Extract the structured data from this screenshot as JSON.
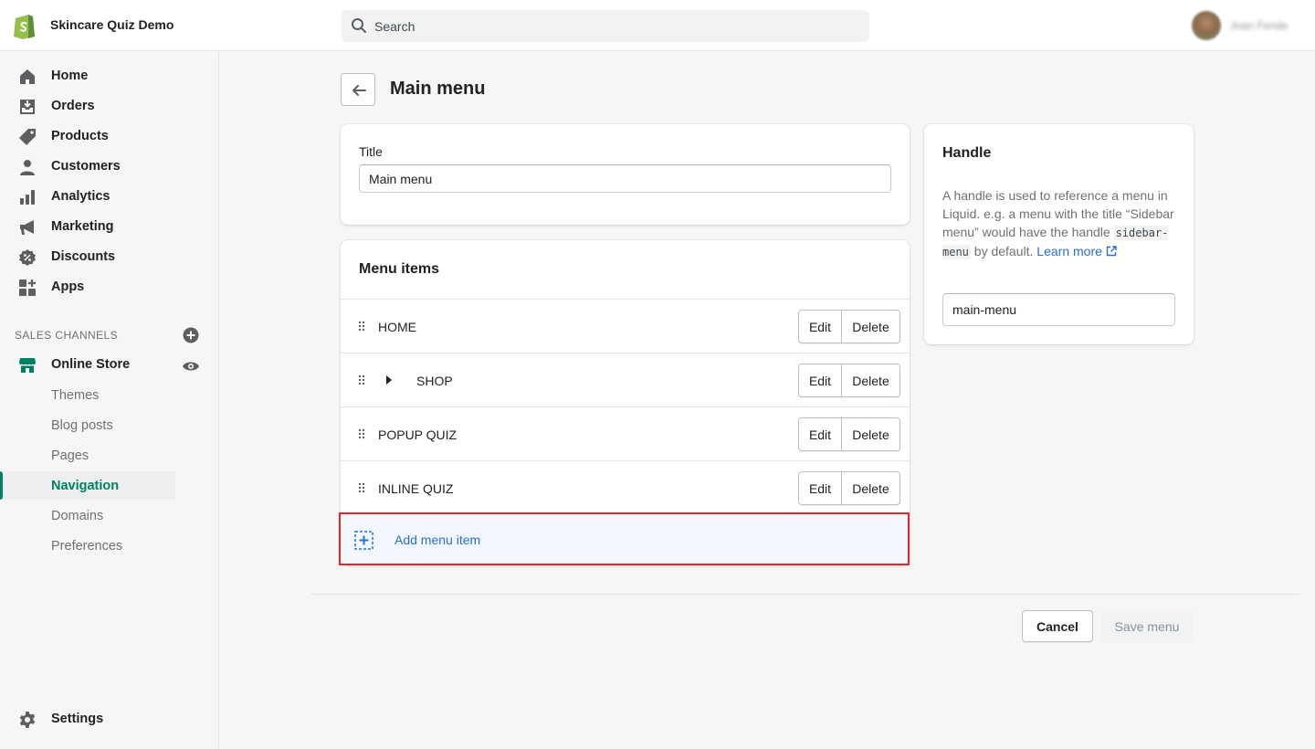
{
  "app": {
    "store_name": "Skincare Quiz Demo",
    "search_placeholder": "Search",
    "user_name": "Joan Fende"
  },
  "sidebar": {
    "items": [
      {
        "label": "Home",
        "icon": "home-icon"
      },
      {
        "label": "Orders",
        "icon": "orders-icon"
      },
      {
        "label": "Products",
        "icon": "tag-icon"
      },
      {
        "label": "Customers",
        "icon": "person-icon"
      },
      {
        "label": "Analytics",
        "icon": "bar-chart-icon"
      },
      {
        "label": "Marketing",
        "icon": "megaphone-icon"
      },
      {
        "label": "Discounts",
        "icon": "discount-icon"
      },
      {
        "label": "Apps",
        "icon": "apps-icon"
      }
    ],
    "sales_channels_title": "SALES CHANNELS",
    "online_store": "Online Store",
    "sub_items": [
      "Themes",
      "Blog posts",
      "Pages",
      "Navigation",
      "Domains",
      "Preferences"
    ],
    "active_sub_item": "Navigation",
    "settings": "Settings"
  },
  "page": {
    "title": "Main menu"
  },
  "title_card": {
    "label": "Title",
    "value": "Main menu"
  },
  "menu_items": {
    "title": "Menu items",
    "rows": [
      {
        "label": "HOME",
        "has_children": false
      },
      {
        "label": "SHOP",
        "has_children": true
      },
      {
        "label": "POPUP QUIZ",
        "has_children": false
      },
      {
        "label": "INLINE QUIZ",
        "has_children": false
      }
    ],
    "edit_label": "Edit",
    "delete_label": "Delete",
    "add_label": "Add menu item"
  },
  "handle": {
    "title": "Handle",
    "desc_part1": "A handle is used to reference a menu in Liquid. e.g. a menu with the title “Sidebar menu” would have the handle ",
    "desc_code": "sidebar-menu",
    "desc_part2": " by default. ",
    "link_text": "Learn more",
    "value": "main-menu"
  },
  "actions": {
    "cancel": "Cancel",
    "save": "Save menu"
  },
  "colors": {
    "brand_green": "#008060",
    "link_blue": "#2c6ecb",
    "highlight_red": "#e32626",
    "add_row_bg": "#f2f7fe"
  }
}
